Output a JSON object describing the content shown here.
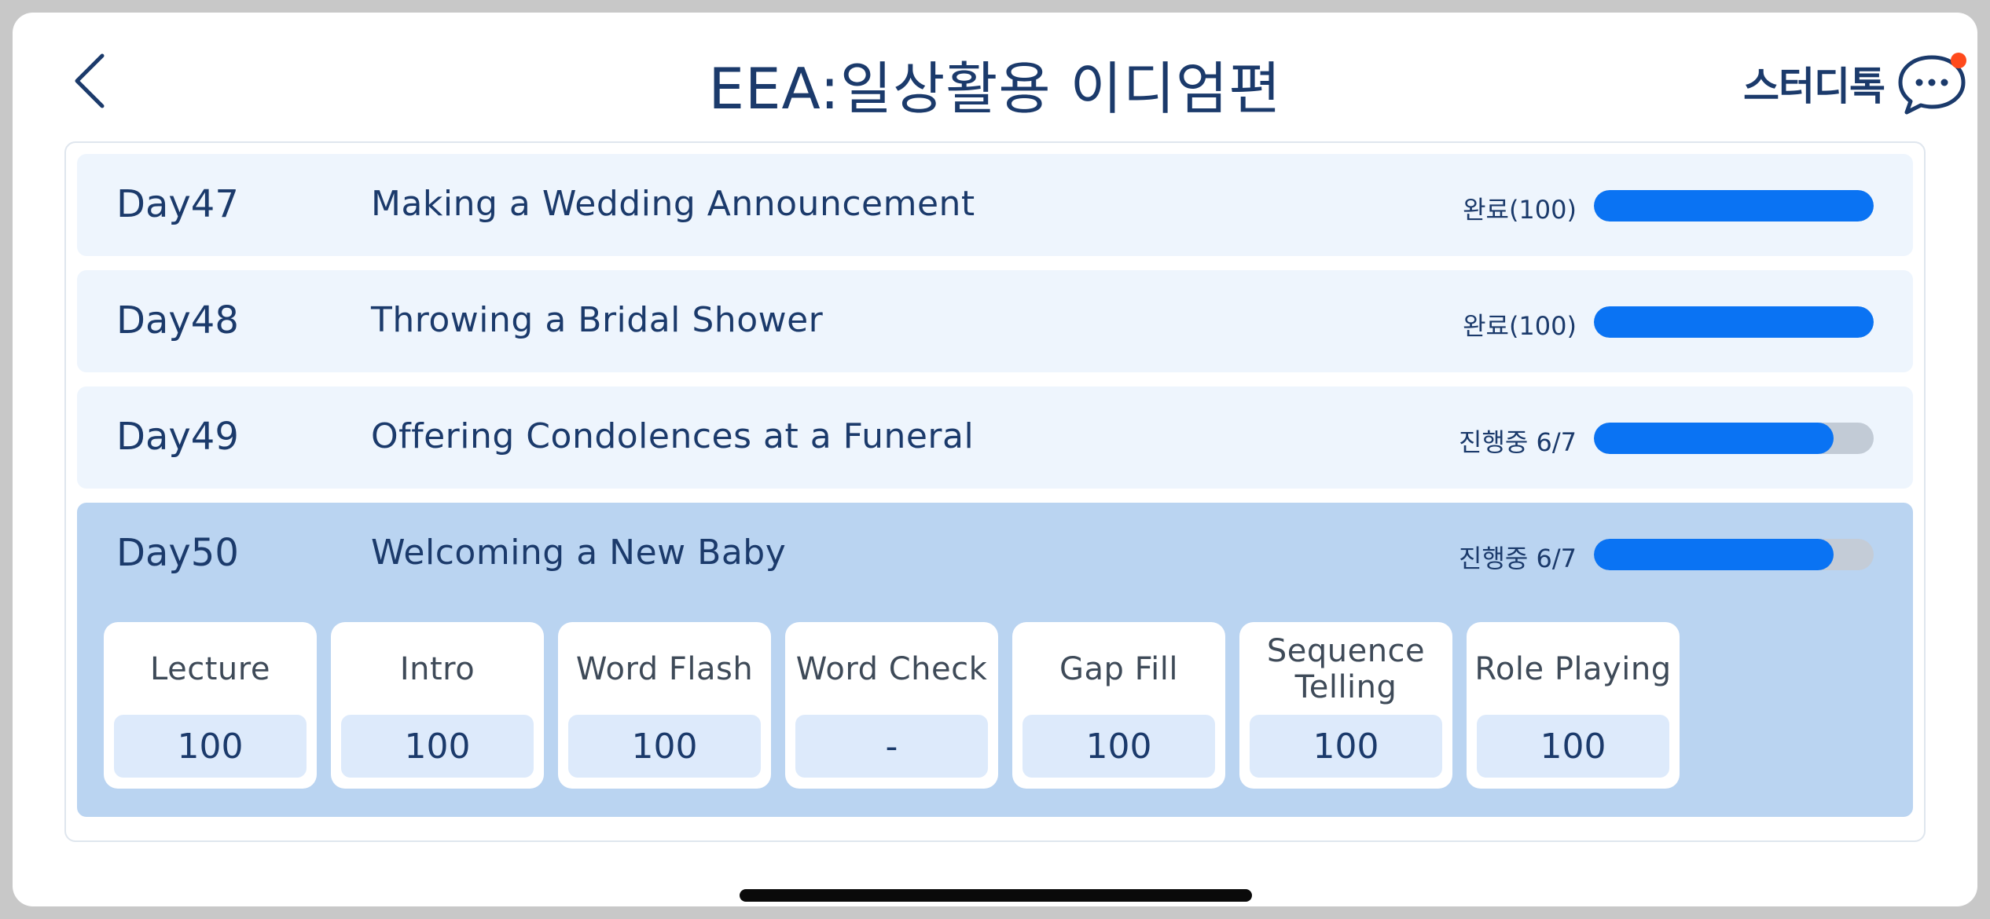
{
  "header": {
    "title": "EEA:일상활용 이디엄편",
    "back_icon": "chevron-left-icon",
    "studytalk_label": "스터디톡",
    "chat_icon": "chat-bubble-icon",
    "notification_dot_color": "#ff4a1c"
  },
  "colors": {
    "accent": "#0a73f3",
    "text": "#1b3a6b",
    "row_bg": "#eef5fd",
    "row_expanded_bg": "#bad4f1",
    "score_bg": "#ddeafb"
  },
  "lessons": [
    {
      "day": "Day47",
      "title": "Making a Wedding Announcement",
      "status": "완료(100)",
      "progress": 1.0
    },
    {
      "day": "Day48",
      "title": "Throwing a Bridal Shower",
      "status": "완료(100)",
      "progress": 1.0
    },
    {
      "day": "Day49",
      "title": "Offering Condolences at a Funeral",
      "status": "진행중 6/7",
      "progress": 0.857
    },
    {
      "day": "Day50",
      "title": "Welcoming a New Baby",
      "status": "진행중 6/7",
      "progress": 0.857,
      "expanded": true,
      "activities": [
        {
          "label": "Lecture",
          "score": "100"
        },
        {
          "label": "Intro",
          "score": "100"
        },
        {
          "label": "Word Flash",
          "score": "100"
        },
        {
          "label": "Word Check",
          "score": "-"
        },
        {
          "label": "Gap Fill",
          "score": "100"
        },
        {
          "label": "Sequence Telling",
          "score": "100"
        },
        {
          "label": "Role Playing",
          "score": "100"
        }
      ]
    }
  ]
}
